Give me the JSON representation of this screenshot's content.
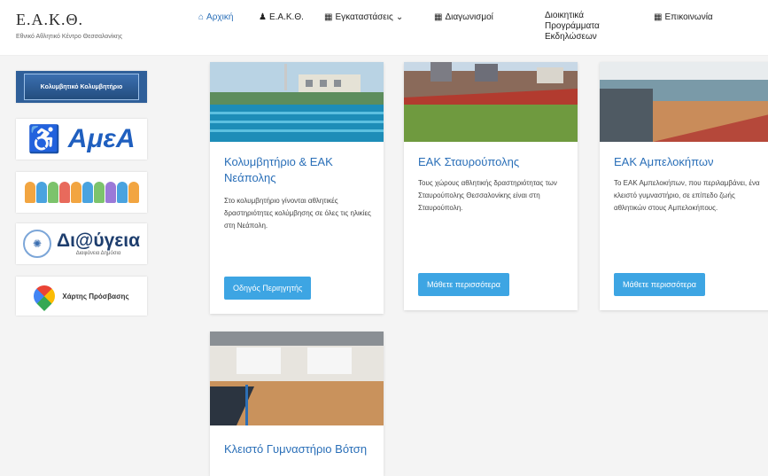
{
  "header": {
    "logo_title": "Ε.Α.Κ.Θ.",
    "logo_subtitle": "Εθνικό Αθλητικό Κέντρο Θεσσαλονίκης",
    "nav": [
      {
        "icon": "home-icon",
        "label": "Αρχική"
      },
      {
        "icon": "user-icon",
        "label": "Ε.Α.Κ.Θ."
      },
      {
        "icon": "grid-icon",
        "label": "Εγκαταστάσεις"
      },
      {
        "icon": "grid-icon",
        "label": "Διαγωνισμοί"
      },
      {
        "icon": "doc-icon",
        "label": "Διοικητικά Προγράμματα Εκδηλώσεων"
      },
      {
        "icon": "grid-icon",
        "label": "Επικοινωνία"
      }
    ]
  },
  "sidebar": {
    "banner1": "Κολυμβητικό Κολυμβητήριο",
    "banner2": "ΑμεΑ",
    "banner4_main": "Δι@ύγεια",
    "banner4_sub": "Διαφάνεια Δημόσια",
    "banner5": "Χάρτης Πρόσβασης"
  },
  "cards": [
    {
      "title": "Κολυμβητήριο & ΕΑΚ Νεάπολης",
      "text": "Στο κολυμβητήριο γίνονται αθλητικές δραστηριότητες κολύμβησης σε όλες τις ηλικίες στη Νεάπολη.",
      "button": "Οδηγός Περιηγητής"
    },
    {
      "title": "ΕΑΚ Σταυρούπολης",
      "text": "Τους χώρους αθλητικής δραστηριότητας των Σταυρούπολης Θεσσαλονίκης είναι στη Σταυρούπολη.",
      "button": "Μάθετε περισσότερα"
    },
    {
      "title": "ΕΑΚ Αμπελοκήπων",
      "text": "Το ΕΑΚ Αμπελοκήπων, που περιλαμβάνει, ένα κλειστό γυμναστήριο, σε επίπεδο ζωής αθλητικών στους Αμπελοκήπους.",
      "button": "Μάθετε περισσότερα"
    },
    {
      "title": "Κλειστό Γυμναστήριο Βότση",
      "text": "",
      "button": ""
    }
  ],
  "colors": {
    "accent": "#3da5e3",
    "link": "#2a6fb8"
  }
}
